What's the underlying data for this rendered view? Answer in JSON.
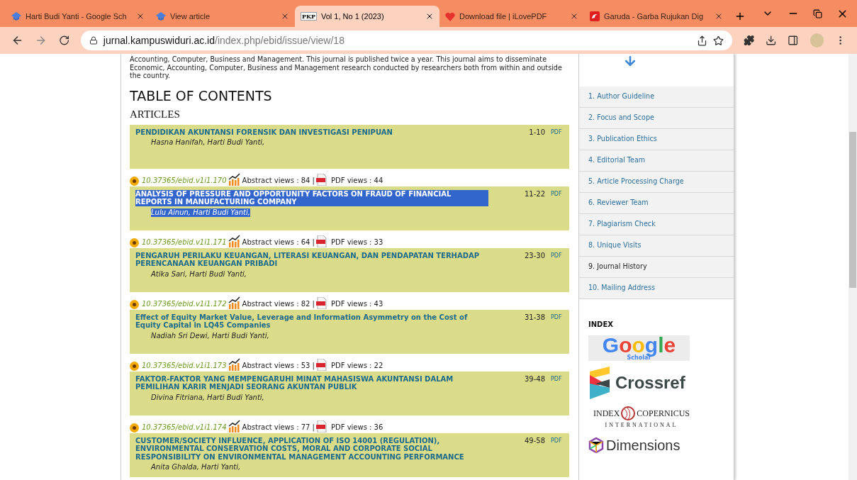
{
  "browser": {
    "tabs": [
      {
        "title": "Harti Budi Yanti - Google Sch",
        "kind": "scholar",
        "selected": false
      },
      {
        "title": "View article",
        "kind": "scholar",
        "selected": false
      },
      {
        "title": "Vol 1, No 1 (2023)",
        "kind": "pkp",
        "icon_text": "PKP",
        "selected": true
      },
      {
        "title": "Download file | iLovePDF",
        "kind": "heart",
        "selected": false
      },
      {
        "title": "Garuda - Garba Rujukan Dig",
        "kind": "garuda",
        "selected": false
      }
    ],
    "url": {
      "host": "jurnal.kampuswiduri.ac.id",
      "path": "/index.php/ebid/issue/view/18"
    }
  },
  "intro": "Accounting, Computer, Business and Management. This journal is published twice a year. This journal aims to disseminate Economic, Accounting, Computer, Business and Management research conducted by researchers both from within and outside the country.",
  "heading": "TABLE OF CONTENTS",
  "section": "ARTICLES",
  "articles": [
    {
      "title": "PENDIDIKAN AKUNTANSI FORENSIK DAN INVESTIGASI PENIPUAN",
      "authors": "Hasna Hanifah, Harti Budi Yanti,",
      "pages": "1-10",
      "galley": "PDF",
      "text_selected": false,
      "doi": "10.37365/ebid.v1i1.170",
      "abstract_views": "Abstract views : 84 |",
      "pdf_views": "PDF views : 44"
    },
    {
      "title": "ANALYSIS OF PRESSURE AND OPPORTUNITY FACTORS ON FRAUD OF FINANCIAL REPORTS IN MANUFACTURING COMPANY",
      "authors": "Lulu Ainun, Harti Budi Yanti,",
      "pages": "11-22",
      "galley": "PDF",
      "text_selected": true,
      "doi": "10.37365/ebid.v1i1.171",
      "abstract_views": "Abstract views : 64 |",
      "pdf_views": "PDF views : 33"
    },
    {
      "title": "PENGARUH PERILAKU KEUANGAN, LITERASI KEUANGAN, DAN PENDAPATAN TERHADAP PERENCANAAN KEUANGAN PRIBADI",
      "authors": "Atika Sari, Harti Budi Yanti,",
      "pages": "23-30",
      "galley": "PDF",
      "text_selected": false,
      "doi": "10.37365/ebid.v1i1.172",
      "abstract_views": "Abstract views : 82 |",
      "pdf_views": "PDF views : 43"
    },
    {
      "title": "Effect of Equity Market Value, Leverage and Information Asymmetry on the Cost of Equity Capital in LQ45 Companies",
      "authors": "Nadiah Sri Dewi, Harti Budi Yanti,",
      "pages": "31-38",
      "galley": "PDF",
      "text_selected": false,
      "doi": "10.37365/ebid.v1i1.173",
      "abstract_views": "Abstract views : 53 |",
      "pdf_views": "PDF views : 22"
    },
    {
      "title": "FAKTOR-FAKTOR YANG MEMPENGARUHI MINAT MAHASISWA AKUNTANSI DALAM PEMILIHAN KARIR MENJADI SEORANG AKUNTAN PUBLIK",
      "authors": "Divina Fitriana, Harti Budi Yanti,",
      "pages": "39-48",
      "galley": "PDF",
      "text_selected": false,
      "doi": "10.37365/ebid.v1i1.174",
      "abstract_views": "Abstract views : 77 |",
      "pdf_views": "PDF views : 36"
    },
    {
      "title": "CUSTOMER/SOCIETY INFLUENCE, APPLICATION OF ISO 14001 (REGULATION), ENVIRONMENTAL CONSERVATION COSTS, MORAL AND CORPORATE SOCIAL RESPONSIBILITY ON ENVIRONMENTAL MANAGEMENT ACCOUNTING PERFORMANCE",
      "authors": "Anita Ghalda, Harti Yanti,",
      "pages": "49-58",
      "galley": "PDF",
      "text_selected": false
    }
  ],
  "sidebar": {
    "menu": [
      {
        "label": "1. Author Guideline",
        "hovered": false
      },
      {
        "label": "2. Focus and Scope",
        "hovered": false
      },
      {
        "label": "3. Publication Ethics",
        "hovered": false
      },
      {
        "label": "4. Editorial Team",
        "hovered": false
      },
      {
        "label": "5. Article Processing Charge",
        "hovered": false
      },
      {
        "label": "6. Reviewer Team",
        "hovered": false
      },
      {
        "label": "7. Plagiarism Check",
        "hovered": false
      },
      {
        "label": "8. Unique Visits",
        "hovered": false
      },
      {
        "label": "9. Journal History",
        "hovered": true
      },
      {
        "label": "10. Mailing Address",
        "hovered": false
      }
    ],
    "index_title": "INDEX",
    "logos": [
      {
        "kind": "google",
        "name": "Google",
        "sub": "Scholar"
      },
      {
        "kind": "crossref",
        "name": "Crossref"
      },
      {
        "kind": "copernicus",
        "name": "INDEX",
        "name2": "COPERNICUS",
        "sub": "INTERNATIONAL"
      },
      {
        "kind": "dimensions",
        "name": "Dimensions"
      }
    ]
  }
}
